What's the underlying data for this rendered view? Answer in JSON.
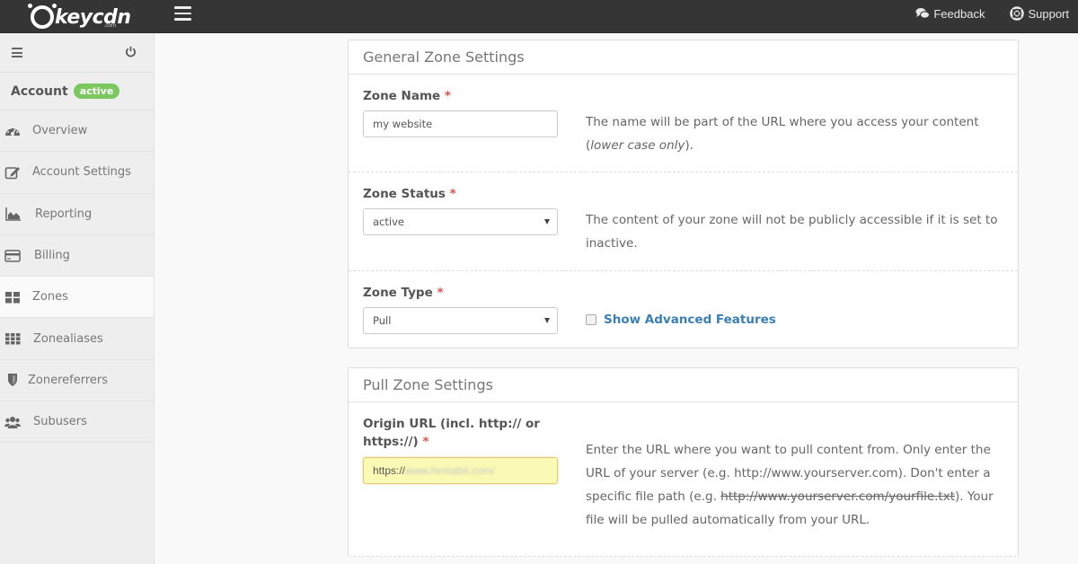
{
  "topbar": {
    "logo_text": "keycdn",
    "logo_sub": ".com",
    "links": [
      {
        "label": "Feedback",
        "icon": "comments-icon"
      },
      {
        "label": "Support",
        "icon": "life-ring-icon"
      }
    ]
  },
  "sidebar": {
    "account_label": "Account",
    "account_status": "active",
    "items": [
      {
        "label": "Overview",
        "icon": "dashboard-icon"
      },
      {
        "label": "Account Settings",
        "icon": "edit-icon"
      },
      {
        "label": "Reporting",
        "icon": "area-chart-icon"
      },
      {
        "label": "Billing",
        "icon": "credit-card-icon"
      },
      {
        "label": "Zones",
        "icon": "grid-icon",
        "active": true
      },
      {
        "label": "Zonealiases",
        "icon": "grid-dots-icon"
      },
      {
        "label": "Zonereferrers",
        "icon": "shield-icon"
      },
      {
        "label": "Subusers",
        "icon": "users-icon"
      }
    ]
  },
  "general": {
    "title": "General Zone Settings",
    "zone_name": {
      "label": "Zone Name",
      "required": "*",
      "value": "my website",
      "help_prefix": "The name will be part of the URL where you access your content (",
      "help_italic": "lower case only",
      "help_suffix": ")."
    },
    "zone_status": {
      "label": "Zone Status",
      "required": "*",
      "value": "active",
      "help": "The content of your zone will not be publicly accessible if it is set to inactive."
    },
    "zone_type": {
      "label": "Zone Type",
      "required": "*",
      "value": "Pull",
      "checkbox_label": "Show Advanced Features",
      "checkbox_checked": false
    }
  },
  "pull": {
    "title": "Pull Zone Settings",
    "origin": {
      "label": "Origin URL (incl. http:// or https://)",
      "required": "*",
      "value_prefix": "https://",
      "value_blurred": "www.hestabit.com/",
      "help_1": "Enter the URL where you want to pull content from. Only enter the URL of your server (e.g. http://www.yourserver.com). Don't enter a specific file path (e.g. ",
      "help_strike": "http://www.yourserver.com/yourfile.txt",
      "help_2": "). Your file will be pulled automatically from your URL."
    }
  }
}
